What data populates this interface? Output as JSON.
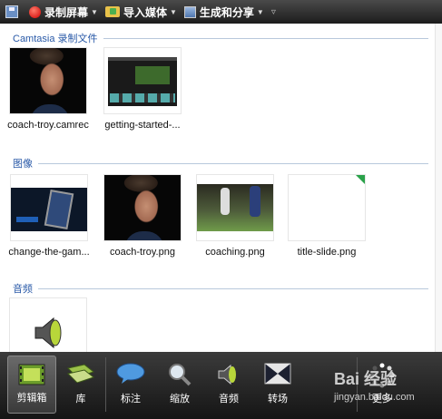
{
  "toolbar": {
    "record_label": "录制屏幕",
    "import_label": "导入媒体",
    "share_label": "生成和分享",
    "extra_label": "▿"
  },
  "sections": {
    "recordings_title": "Camtasia 录制文件",
    "images_title": "图像",
    "audio_title": "音频"
  },
  "recordings": [
    {
      "caption": "coach-troy.camrec",
      "thumb": "face"
    },
    {
      "caption": "getting-started-...",
      "thumb": "editor"
    }
  ],
  "images": [
    {
      "caption": "change-the-gam...",
      "thumb": "phones"
    },
    {
      "caption": "coach-troy.png",
      "thumb": "face"
    },
    {
      "caption": "coaching.png",
      "thumb": "baseball"
    },
    {
      "caption": "title-slide.png",
      "thumb": "slide"
    }
  ],
  "audio": [
    {
      "caption": "",
      "thumb": "speaker-icon"
    }
  ],
  "tabs": [
    {
      "label": "剪辑箱",
      "icon": "film-clip-icon",
      "active": true
    },
    {
      "label": "库",
      "icon": "library-icon",
      "active": false
    },
    {
      "label": "标注",
      "icon": "callout-icon",
      "active": false
    },
    {
      "label": "缩放",
      "icon": "zoom-icon",
      "active": false
    },
    {
      "label": "音频",
      "icon": "speaker-icon",
      "active": false
    },
    {
      "label": "转场",
      "icon": "transition-icon",
      "active": false
    },
    {
      "label": "更多",
      "icon": "more-icon",
      "active": false
    }
  ],
  "watermark": {
    "brand": "Bai 经验",
    "site": "jingyan.baidu.com"
  },
  "colors": {
    "section_title": "#2a5aa8",
    "toolbar_bg": "#2a2a2a",
    "tabbar_bg": "#1e1e1e"
  }
}
